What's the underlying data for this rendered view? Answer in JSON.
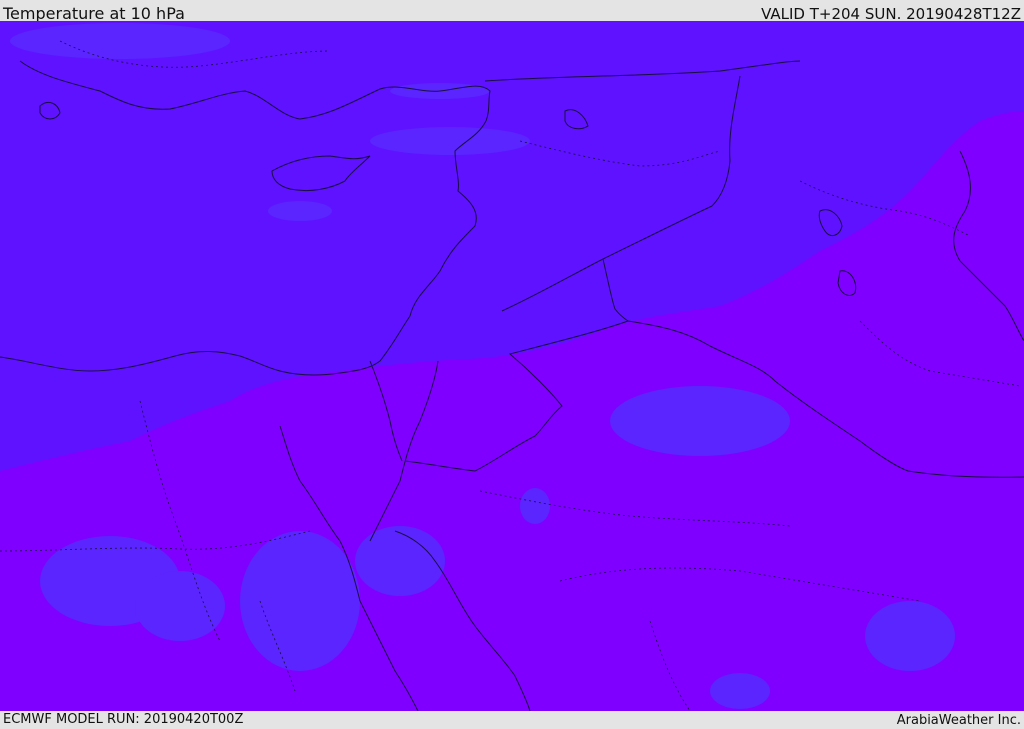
{
  "header": {
    "title": "Temperature at 10 hPa",
    "valid": "VALID T+204 SUN. 20190428T12Z"
  },
  "footer": {
    "model_run": "ECMWF MODEL RUN: 20190420T00Z",
    "credit": "ArabiaWeather Inc."
  },
  "map": {
    "field": "temperature",
    "level": "10 hPa",
    "colors": {
      "warmer_band": "#5f12ff",
      "colder_band": "#7f00ff",
      "patch": "#5a25ff",
      "border_line": "#1b0f44"
    }
  }
}
